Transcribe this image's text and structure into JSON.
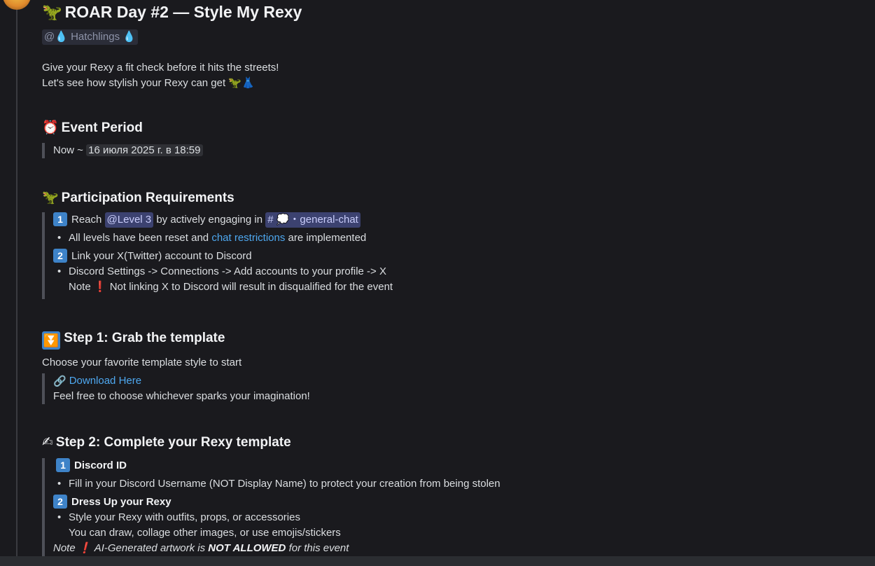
{
  "title": "ROAR Day #2 — Style My Rexy",
  "title_emoji": "🦖",
  "role_tag": "@💧 Hatchlings 💧",
  "intro": [
    "Give your Rexy a fit check before it hits the streets!",
    "Let's see how stylish your Rexy can get 🦖👗"
  ],
  "event": {
    "emoji": "⏰",
    "heading": "Event Period",
    "prefix": "Now ~",
    "date": "16 июля 2025 г. в 18:59"
  },
  "requirements": {
    "emoji": "🦖",
    "heading": "Participation Requirements",
    "k1": "1",
    "line1_pre": "Reach",
    "level": "@Level 3",
    "line1_mid": "by actively engaging in",
    "channel": "# 💭・general-chat",
    "b1_pre": "All levels have been reset and",
    "b1_link": "chat restrictions",
    "b1_post": "are implemented",
    "k2": "2",
    "line2": "Link your X(Twitter) account to Discord",
    "b2": "Discord Settings -> Connections -> Add accounts to your profile -> X",
    "note_pre": "Note",
    "note_mark": "❗",
    "note_post": "Not linking X to Discord will result in disqualified for the event"
  },
  "step1": {
    "emoji": "⏬",
    "heading": "Step 1: Grab the template",
    "text": "Choose your favorite template style to start",
    "link_emoji": "🔗",
    "link": "Download Here",
    "tail": "Feel free to choose whichever sparks your imagination!"
  },
  "step2": {
    "emoji": "✍",
    "heading": "Step 2: Complete your Rexy template",
    "k1": "1",
    "sub1": "Discord ID",
    "b1": "Fill in your Discord Username (NOT Display Name) to protect your creation from being stolen",
    "k2": "2",
    "sub2": "Dress Up your Rexy",
    "b2a": "Style your Rexy with outfits, props, or accessories",
    "b2b": "You can draw, collage other images, or use emojis/stickers",
    "note_pre": "Note",
    "note_mark": "❗",
    "note_mid": "AI-Generated artwork is",
    "note_bold": "NOT ALLOWED",
    "note_post": "for this event"
  },
  "colors": {
    "bg": "#1a1a1e",
    "link": "#4ea8f0",
    "keycap": "#3e83c8",
    "mention_bg": "#3c4270"
  }
}
